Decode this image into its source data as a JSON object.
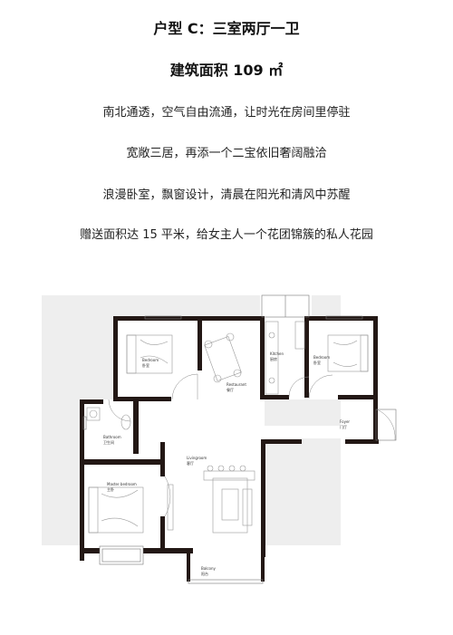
{
  "heading": {
    "title": "户型 C：三室两厅一卫",
    "area": "建筑面积 109 ㎡"
  },
  "features": [
    "南北通透，空气自由流通，让时光在房间里停驻",
    "宽敞三居，再添一个二宝依旧奢阔融洽",
    "浪漫卧室，飘窗设计，清晨在阳光和清风中苏醒",
    "赠送面积达 15 平米，给女主人一个花团锦簇的私人花园"
  ],
  "floorplan": {
    "rooms": {
      "bedroom_left": {
        "en": "Bedroom",
        "cn": "卧室"
      },
      "restaurant": {
        "en": "Restaurant",
        "cn": "餐厅"
      },
      "kitchen": {
        "en": "Kitchen",
        "cn": "厨房"
      },
      "bedroom_right": {
        "en": "Bedroom",
        "cn": "卧室"
      },
      "foyer": {
        "en": "Foyer",
        "cn": "门厅"
      },
      "bathroom": {
        "en": "Bathroom",
        "cn": "卫生间"
      },
      "livingroom": {
        "en": "Livingroom",
        "cn": "客厅"
      },
      "master_bedroom": {
        "en": "Master bedroom",
        "cn": "主卧"
      },
      "balcony": {
        "en": "Balcony",
        "cn": "阳台"
      }
    }
  }
}
